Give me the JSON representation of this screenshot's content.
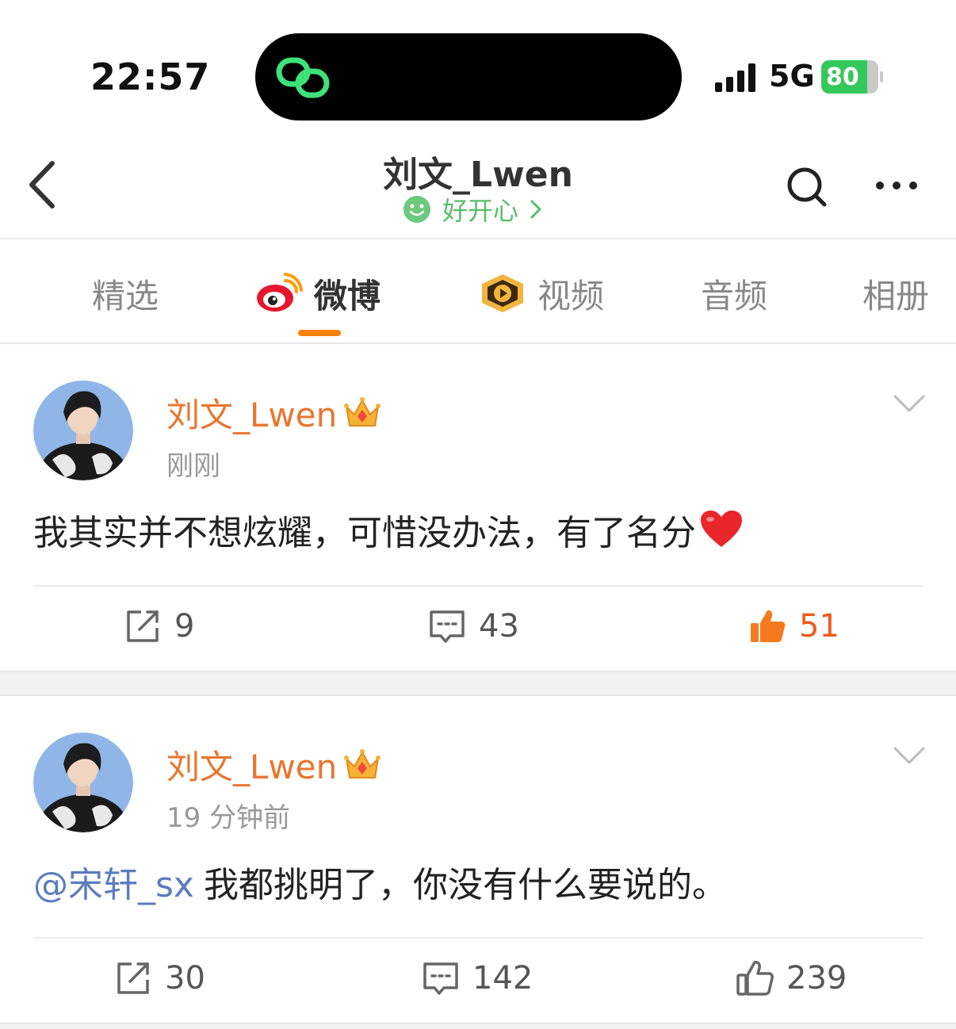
{
  "status_bar": {
    "time": "22:57",
    "network": "5G",
    "battery": "80",
    "battery_level": 0.8,
    "accent": "#34c759"
  },
  "header": {
    "title": "刘文_Lwen",
    "subtitle": "好开心",
    "subtitle_color": "#57bd6a",
    "icons": [
      "back-icon",
      "smile-icon",
      "search-icon",
      "more-icon"
    ]
  },
  "tabs": [
    {
      "label": "精选",
      "active": false
    },
    {
      "label": "微博",
      "active": true,
      "icon": "weibo-logo-icon"
    },
    {
      "label": "视频",
      "active": false,
      "icon": "video-play-icon"
    },
    {
      "label": "音频",
      "active": false
    },
    {
      "label": "相册",
      "active": false
    }
  ],
  "tab_accent": "#ff8200",
  "posts": [
    {
      "author": "刘文_Lwen",
      "time": "刚刚",
      "text": "我其实并不想炫耀，可惜没办法，有了名分",
      "emoji": "heart-icon",
      "reposts": "9",
      "comments": "43",
      "likes": "51",
      "liked": true
    },
    {
      "author": "刘文_Lwen",
      "time": "19 分钟前",
      "mention": "@宋轩_sx",
      "text": "我都挑明了，你没有什么要说的。",
      "reposts": "30",
      "comments": "142",
      "likes": "239",
      "liked": false
    }
  ],
  "colors": {
    "author": "#e8762f",
    "mention": "#5a7cbf",
    "liked": "#f35a1c"
  }
}
